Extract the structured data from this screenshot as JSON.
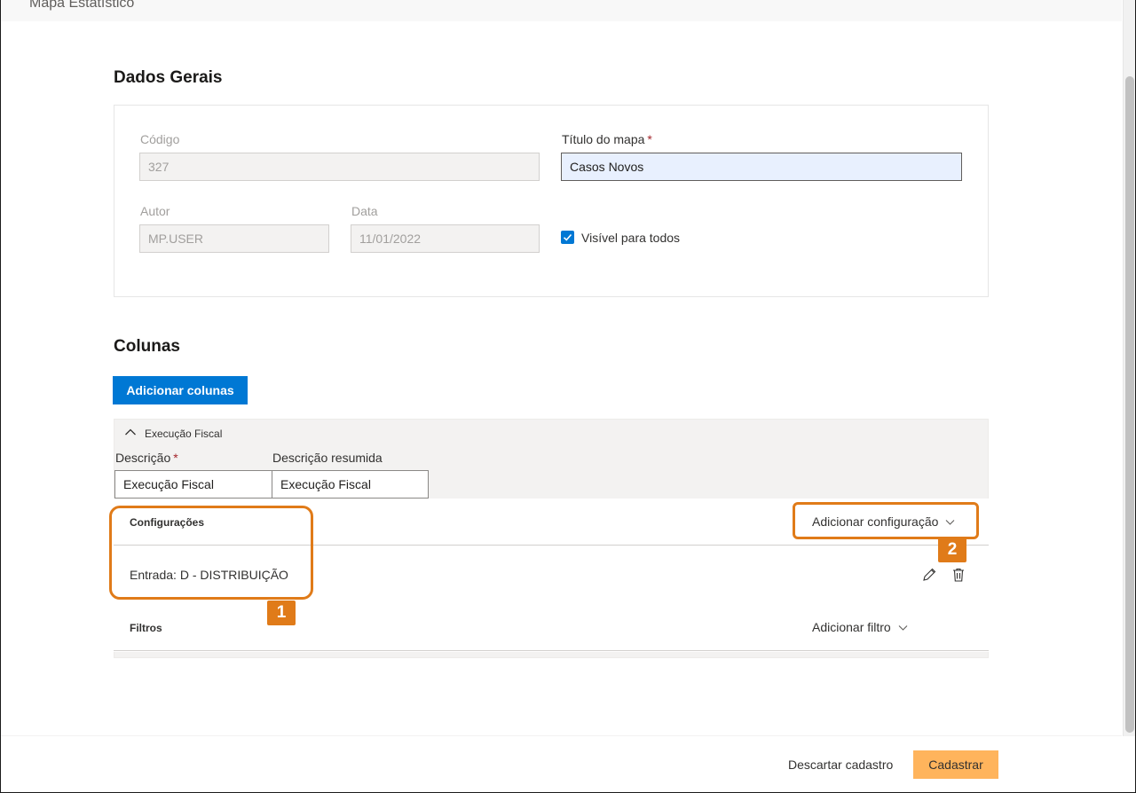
{
  "header": {
    "title": "Mapa Estatístico"
  },
  "dados_gerais": {
    "title": "Dados Gerais",
    "codigo_label": "Código",
    "codigo_value": "327",
    "titulo_label": "Título do mapa",
    "titulo_required": "*",
    "titulo_value": "Casos Novos",
    "autor_label": "Autor",
    "autor_value": "MP.USER",
    "data_label": "Data",
    "data_value": "11/01/2022",
    "visivel_label": "Visível para todos",
    "visivel_checked": true
  },
  "colunas": {
    "title": "Colunas",
    "add_button": "Adicionar colunas",
    "group": {
      "name": "Execução Fiscal",
      "descricao_label": "Descrição",
      "descricao_required": "*",
      "descricao_value": "Execução Fiscal",
      "resumida_label": "Descrição resumida",
      "resumida_value": "Execução Fiscal",
      "configuracoes_label": "Configurações",
      "add_config": "Adicionar configuração",
      "config_entry": "Entrada: D - DISTRIBUIÇÃO",
      "filtros_label": "Filtros",
      "add_filtro": "Adicionar filtro"
    }
  },
  "callouts": {
    "one": "1",
    "two": "2"
  },
  "footer": {
    "discard": "Descartar cadastro",
    "submit": "Cadastrar"
  },
  "colors": {
    "accent": "#0078d4",
    "callout": "#e07b19",
    "submit": "#ffb45c",
    "required": "#a4262c"
  }
}
